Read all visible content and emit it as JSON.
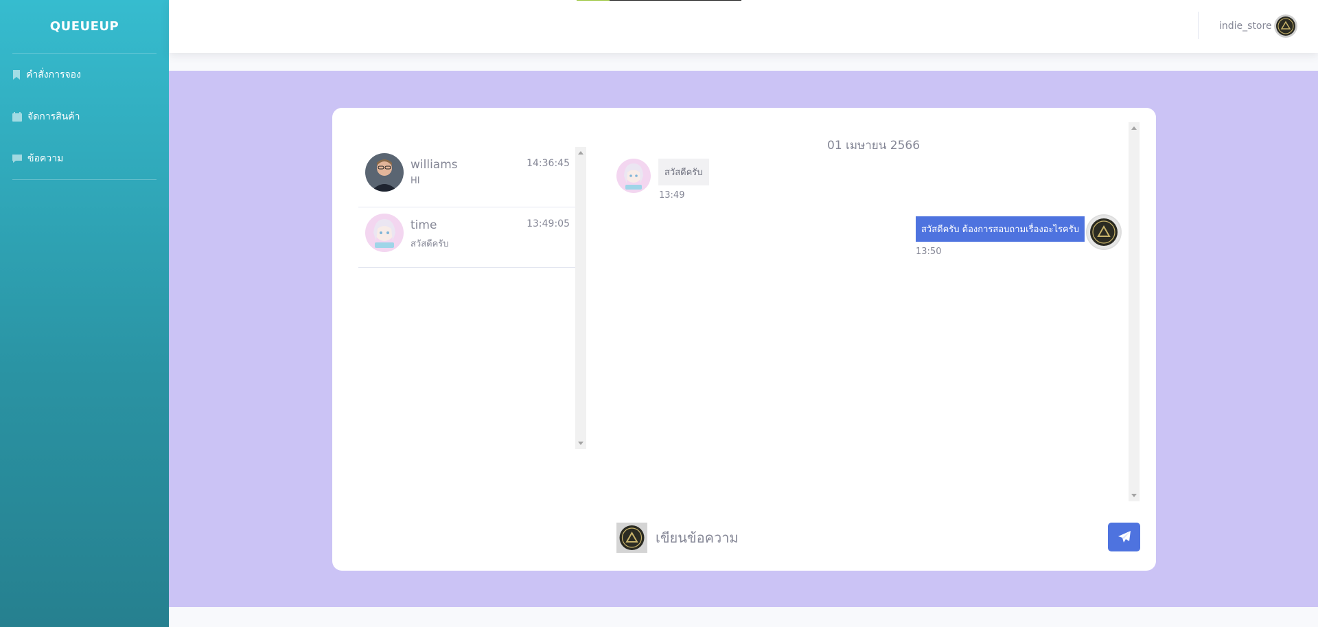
{
  "app": {
    "brand": "QUEUEUP"
  },
  "sidebar": {
    "items": [
      {
        "label": "คำสั่งการจอง",
        "icon": "bookmark-icon"
      },
      {
        "label": "จัดการสินค้า",
        "icon": "calendar-icon"
      },
      {
        "label": "ข้อความ",
        "icon": "comment-icon"
      }
    ]
  },
  "topbar": {
    "username": "indie_store"
  },
  "conversations": [
    {
      "name": "williams",
      "preview": "HI",
      "time": "14:36:45",
      "avatar": "man-avatar"
    },
    {
      "name": "time",
      "preview": "สวัสดีครับ",
      "time": "13:49:05",
      "avatar": "anime-avatar"
    }
  ],
  "chat": {
    "date": "01 เมษายน 2566",
    "messages": [
      {
        "direction": "incoming",
        "text": "สวัสดีครับ",
        "time": "13:49"
      },
      {
        "direction": "outgoing",
        "text": "สวัสดีครับ ต้องการสอบถามเรื่องอะไรครับ",
        "time": "13:50"
      }
    ]
  },
  "composer": {
    "placeholder": "เขียนข้อความ",
    "send_icon": "paper-plane-icon"
  },
  "colors": {
    "sidebar_top": "#36bccf",
    "sidebar_bottom": "#26808f",
    "content_bg": "#cbc3f5",
    "accent": "#4e73df"
  }
}
